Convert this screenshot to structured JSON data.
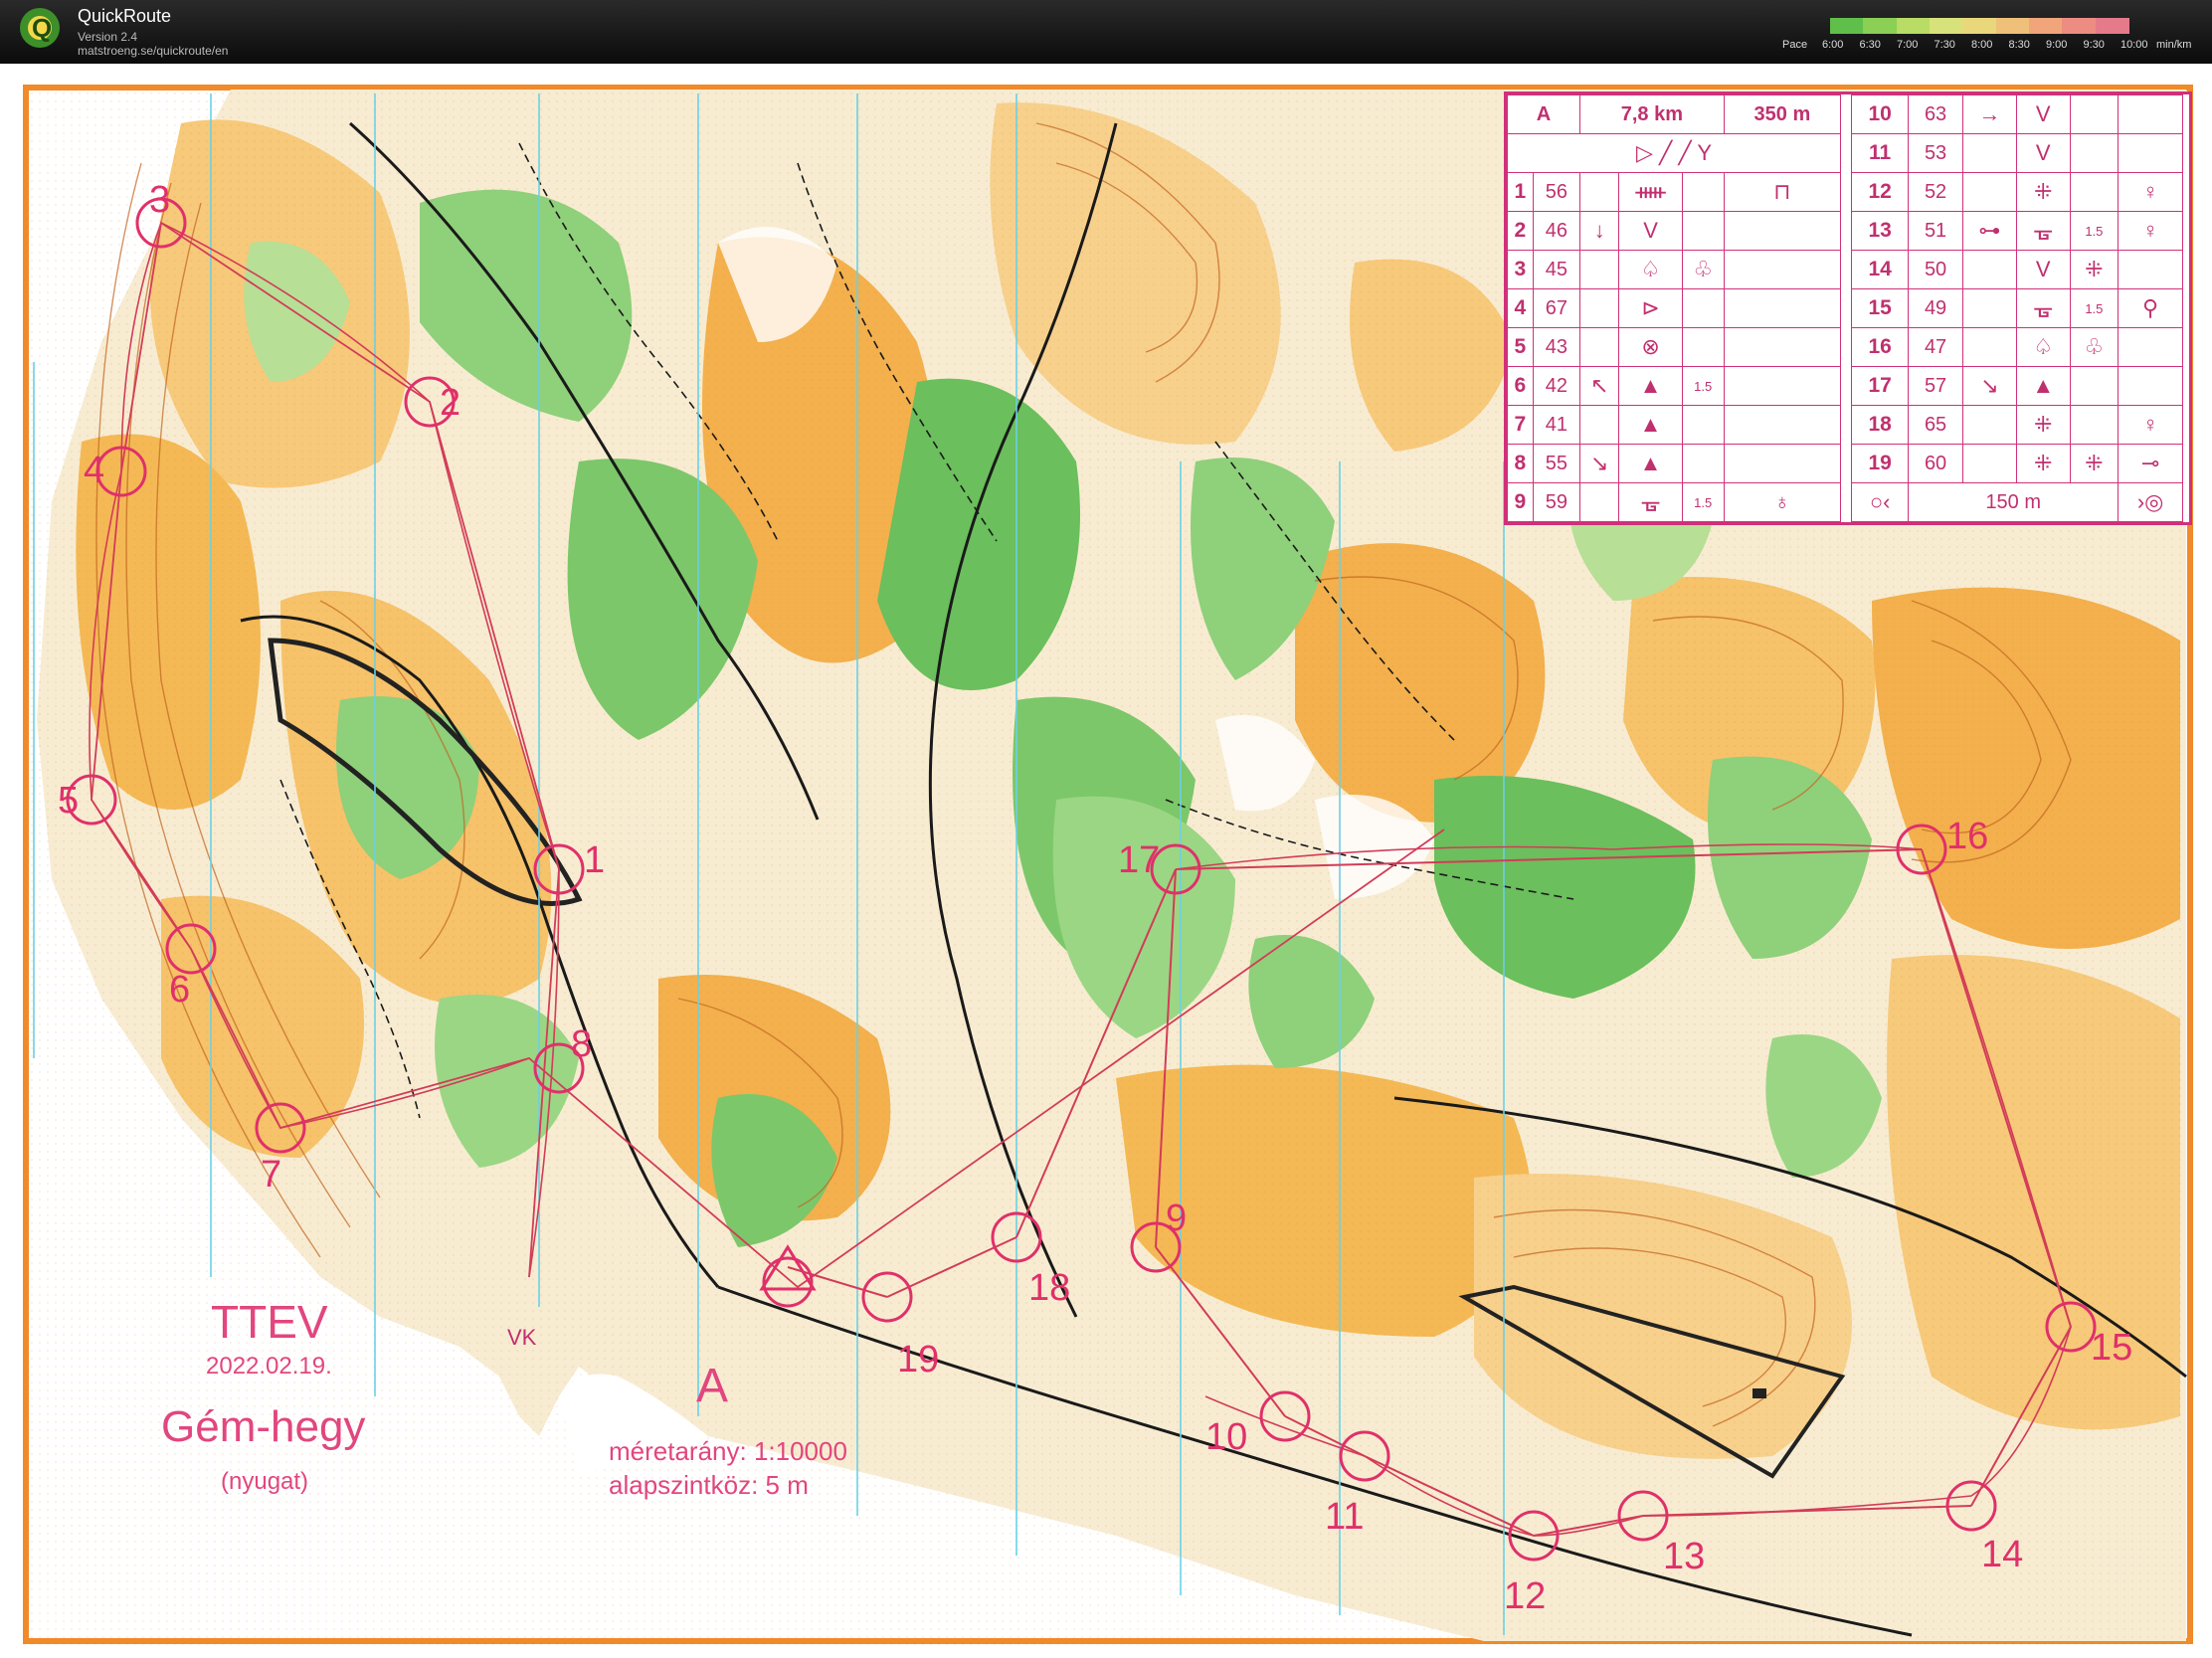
{
  "app": {
    "title": "QuickRoute",
    "version": "Version 2.4",
    "url": "matstroeng.se/quickroute/en",
    "logo_letter": "Q"
  },
  "pace_legend": {
    "label": "Pace",
    "ticks": [
      "6:00",
      "6:30",
      "7:00",
      "7:30",
      "8:00",
      "8:30",
      "9:00",
      "9:30",
      "10:00"
    ],
    "unit": "min/km",
    "colors": [
      "#5fbf4a",
      "#8bcf55",
      "#b8dc66",
      "#d8e27a",
      "#e9d77c",
      "#efc07a",
      "#f0a57a",
      "#ec8c82",
      "#e57a8a"
    ]
  },
  "map_text": {
    "club": "TTEV",
    "date": "2022.02.19.",
    "area": "Gém-hegy",
    "area_sub": "(nyugat)",
    "course": "A",
    "scale": "méretarány: 1:10000",
    "contour": "alapszintköz: 5 m",
    "vk": "VK"
  },
  "controls": [
    {
      "n": "1"
    },
    {
      "n": "2"
    },
    {
      "n": "3"
    },
    {
      "n": "4"
    },
    {
      "n": "5"
    },
    {
      "n": "6"
    },
    {
      "n": "7"
    },
    {
      "n": "8"
    },
    {
      "n": "9"
    },
    {
      "n": "10"
    },
    {
      "n": "11"
    },
    {
      "n": "12"
    },
    {
      "n": "13"
    },
    {
      "n": "14"
    },
    {
      "n": "15"
    },
    {
      "n": "16"
    },
    {
      "n": "17"
    },
    {
      "n": "18"
    },
    {
      "n": "19"
    }
  ],
  "descriptions": {
    "header": {
      "course": "A",
      "length": "7,8 km",
      "climb": "350 m"
    },
    "start_symbols": "▷ ╱ ╱ Y",
    "left": [
      {
        "n": "1",
        "code": "56",
        "dir": "",
        "feat": "ᚔ",
        "extra": "",
        "loc": "⊓"
      },
      {
        "n": "2",
        "code": "46",
        "dir": "↓",
        "feat": "V",
        "extra": "",
        "loc": ""
      },
      {
        "n": "3",
        "code": "45",
        "dir": "",
        "feat": "♤",
        "extra": "♧",
        "loc": ""
      },
      {
        "n": "4",
        "code": "67",
        "dir": "",
        "feat": "⊳",
        "extra": "",
        "loc": ""
      },
      {
        "n": "5",
        "code": "43",
        "dir": "",
        "feat": "⊗",
        "extra": "",
        "loc": ""
      },
      {
        "n": "6",
        "code": "42",
        "dir": "↖",
        "feat": "▲",
        "extra": "1.5",
        "loc": ""
      },
      {
        "n": "7",
        "code": "41",
        "dir": "",
        "feat": "▲",
        "extra": "",
        "loc": ""
      },
      {
        "n": "8",
        "code": "55",
        "dir": "↘",
        "feat": "▲",
        "extra": "",
        "loc": ""
      },
      {
        "n": "9",
        "code": "59",
        "dir": "",
        "feat": "ᚗ",
        "extra": "1.5",
        "loc": "♁"
      }
    ],
    "right": [
      {
        "n": "10",
        "code": "63",
        "dir": "→",
        "feat": "V",
        "extra": "",
        "loc": ""
      },
      {
        "n": "11",
        "code": "53",
        "dir": "",
        "feat": "V",
        "extra": "",
        "loc": ""
      },
      {
        "n": "12",
        "code": "52",
        "dir": "",
        "feat": "⁜",
        "extra": "",
        "loc": "♀"
      },
      {
        "n": "13",
        "code": "51",
        "dir": "⊶",
        "feat": "ᚗ",
        "extra": "1.5",
        "loc": "♀"
      },
      {
        "n": "14",
        "code": "50",
        "dir": "",
        "feat": "V",
        "extra": "⁜",
        "loc": ""
      },
      {
        "n": "15",
        "code": "49",
        "dir": "",
        "feat": "ᚗ",
        "extra": "1.5",
        "loc": "⚲"
      },
      {
        "n": "16",
        "code": "47",
        "dir": "",
        "feat": "♤",
        "extra": "♧",
        "loc": ""
      },
      {
        "n": "17",
        "code": "57",
        "dir": "↘",
        "feat": "▲",
        "extra": "",
        "loc": ""
      },
      {
        "n": "18",
        "code": "65",
        "dir": "",
        "feat": "⁜",
        "extra": "",
        "loc": "♀"
      },
      {
        "n": "19",
        "code": "60",
        "dir": "",
        "feat": "⁜",
        "extra": "⁜",
        "loc": "⊸"
      }
    ],
    "finish": {
      "length": "150 m"
    }
  },
  "colors": {
    "pink": "#e2467e",
    "route": "#d23c58",
    "orange": "#f2a33a",
    "light_orange": "#f7d28a",
    "green": "#79c56b",
    "light_green": "#b7df96",
    "magnetic_line": "#6ad0e6"
  }
}
